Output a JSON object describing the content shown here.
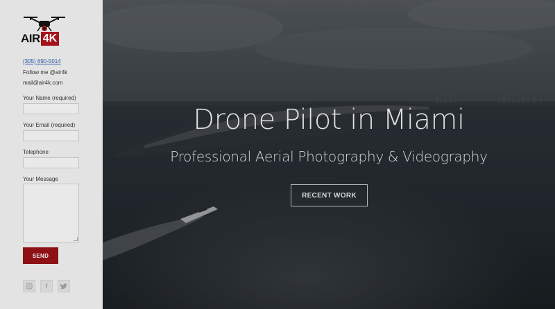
{
  "sidebar": {
    "logo": {
      "text_air": "AIR",
      "text_4k": "4K",
      "brand_color": "#a3141a",
      "icon": "drone-icon"
    },
    "contact": {
      "phone": "(305) 690-5014",
      "follow": "Follow me @air4k",
      "email": "mail@air4k.com"
    },
    "form": {
      "name_label": "Your Name (required)",
      "email_label": "Your Email (required)",
      "telephone_label": "Telephone",
      "message_label": "Your Message",
      "name_value": "",
      "email_value": "",
      "telephone_value": "",
      "message_value": "",
      "send_label": "SEND",
      "send_color": "#8c1015"
    },
    "social": [
      {
        "icon": "instagram-icon"
      },
      {
        "icon": "facebook-icon"
      },
      {
        "icon": "twitter-icon"
      }
    ]
  },
  "hero": {
    "title": "Drone Pilot in Miami",
    "subtitle": "Professional Aerial Photography & Videography",
    "button_label": "RECENT WORK"
  }
}
